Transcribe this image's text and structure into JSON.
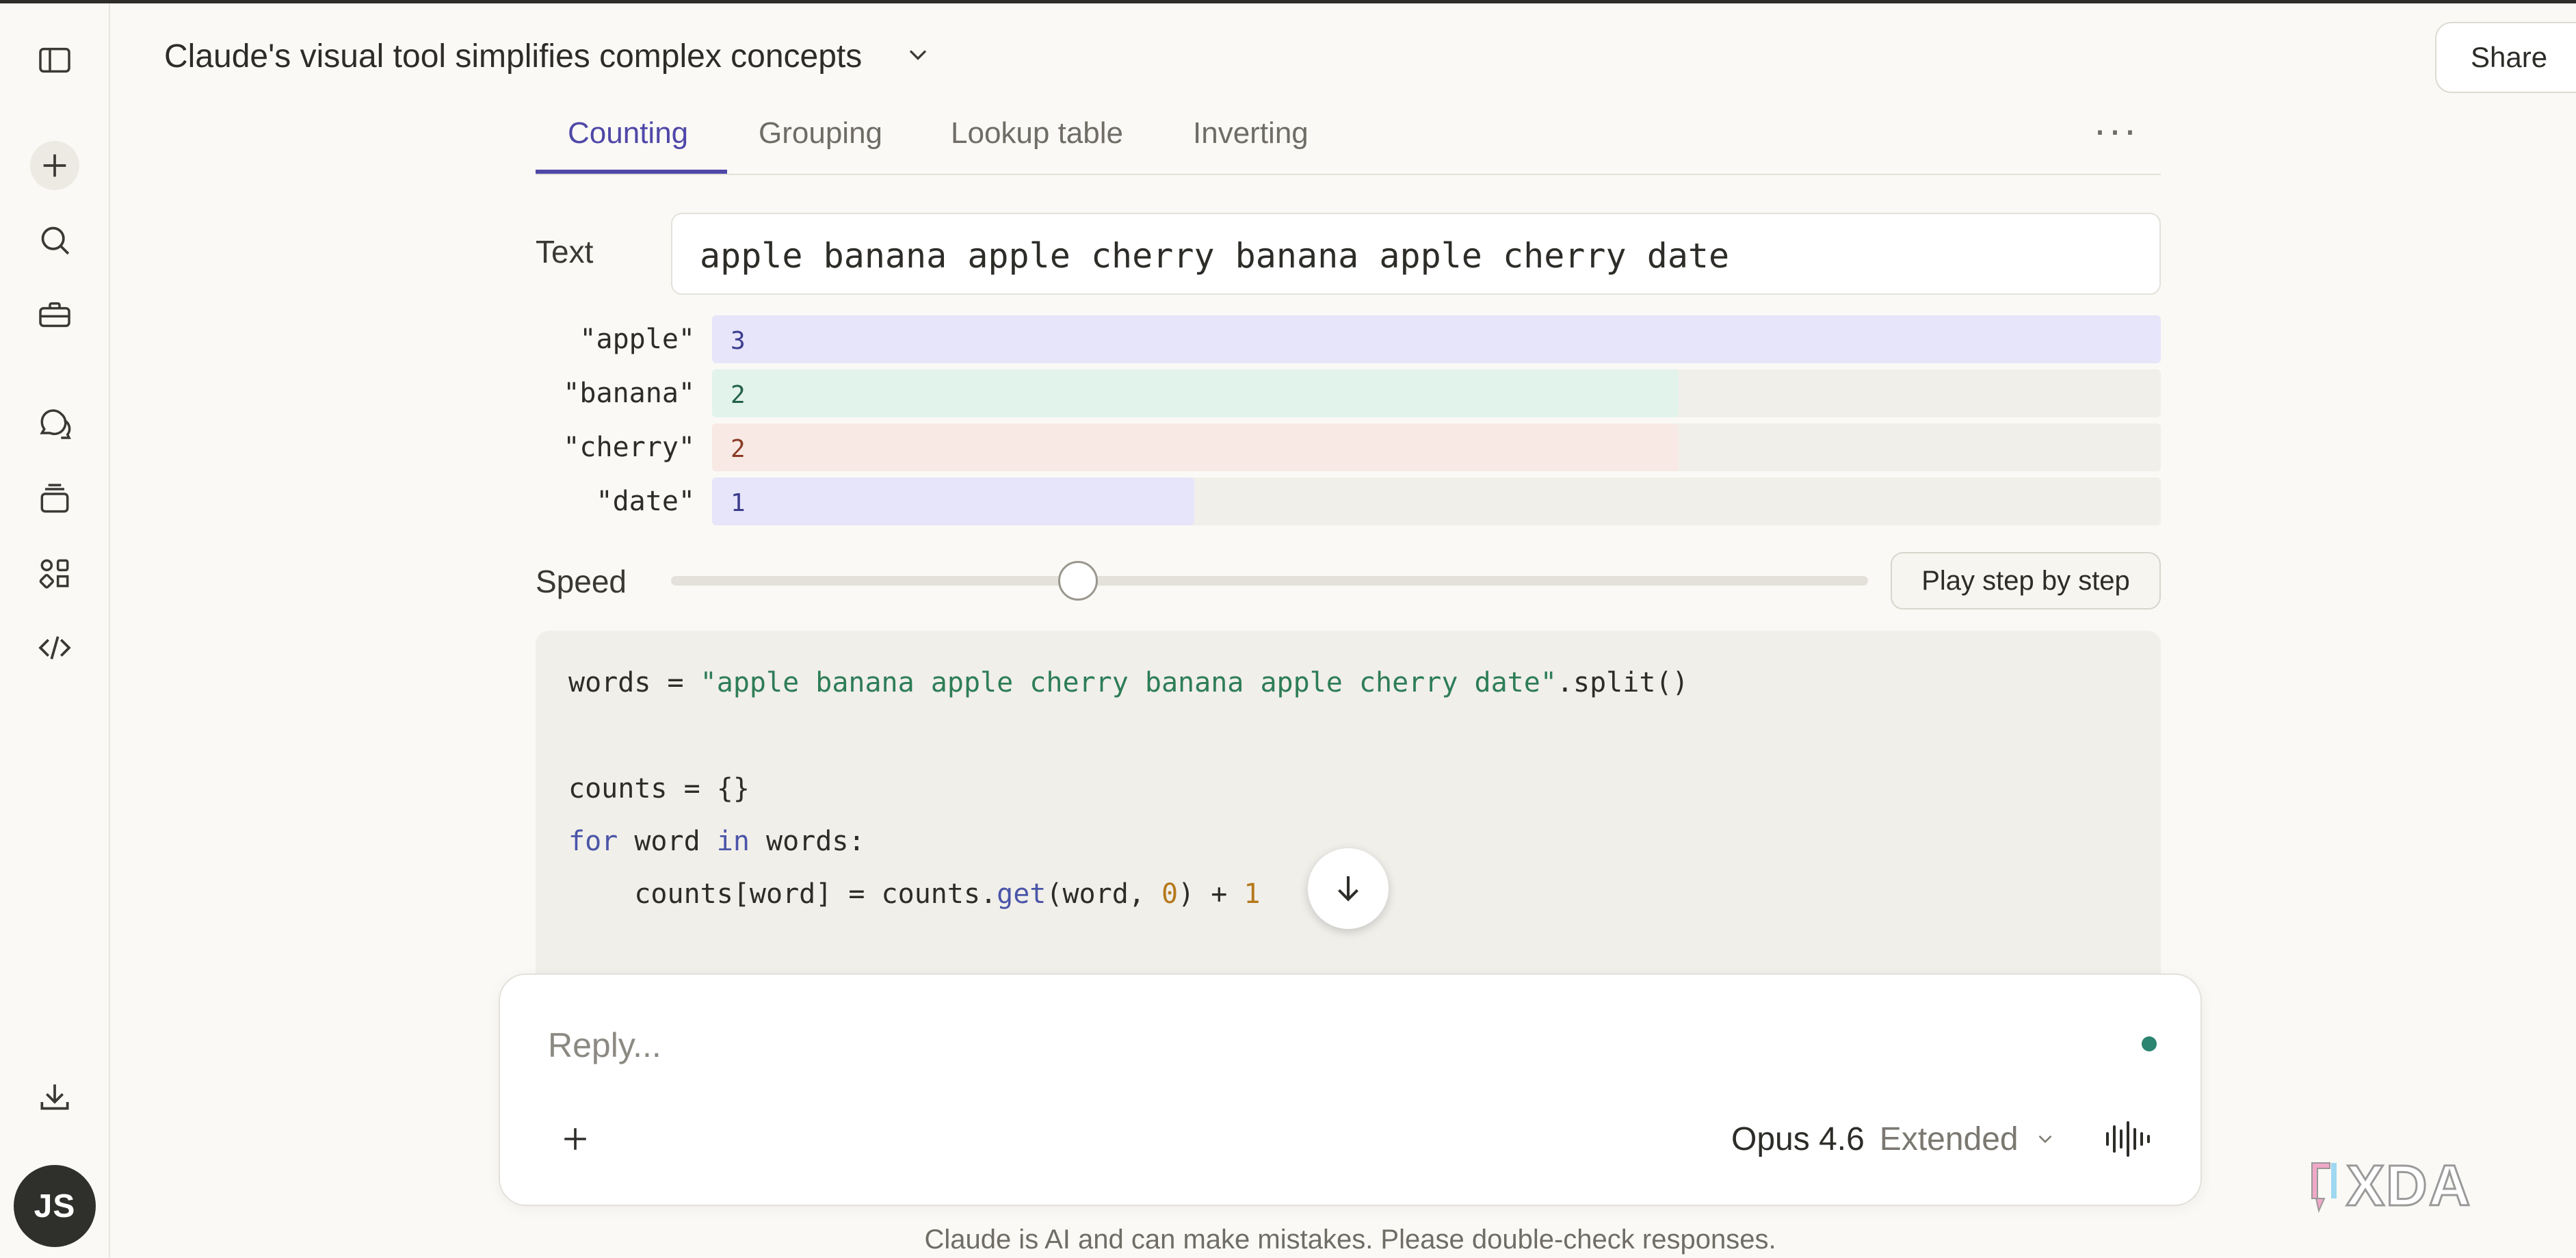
{
  "header": {
    "title": "Claude's visual tool simplifies complex concepts",
    "share_label": "Share"
  },
  "sidebar": {
    "avatar_initials": "JS",
    "icons": [
      "sidebar-toggle-icon",
      "new-chat-icon",
      "search-icon",
      "toolbox-icon",
      "chats-icon",
      "projects-icon",
      "artifacts-icon",
      "code-icon",
      "download-icon"
    ]
  },
  "artifact": {
    "tabs": [
      "Counting",
      "Grouping",
      "Lookup table",
      "Inverting"
    ],
    "active_tab": "Counting",
    "text_label": "Text",
    "text_value": "apple banana apple cherry banana apple cherry date",
    "counts": [
      {
        "word": "\"apple\"",
        "count": "3",
        "fraction": 1.0,
        "fill": "#e6e5fa",
        "color": "#3b3c8c"
      },
      {
        "word": "\"banana\"",
        "count": "2",
        "fraction": 0.667,
        "fill": "#e2f3ec",
        "color": "#23624a"
      },
      {
        "word": "\"cherry\"",
        "count": "2",
        "fraction": 0.667,
        "fill": "#f8e9e4",
        "color": "#8a3b24"
      },
      {
        "word": "\"date\"",
        "count": "1",
        "fraction": 0.333,
        "fill": "#e6e5fa",
        "color": "#3b3c8c"
      }
    ],
    "speed_label": "Speed",
    "speed_level": 0.34,
    "play_label": "Play step by step",
    "code": {
      "l1_a": "words = ",
      "l1_str": "\"apple banana apple cherry banana apple cherry date\"",
      "l1_b": ".split()",
      "l2": "counts = {}",
      "l3_kw1": "for",
      "l3_a": " word ",
      "l3_kw2": "in",
      "l3_b": " words:",
      "l4_a": "    counts[word] = counts.",
      "l4_fn": "get",
      "l4_b": "(word, ",
      "l4_num1": "0",
      "l4_c": ") + ",
      "l4_num2": "1"
    }
  },
  "composer": {
    "placeholder": "Reply...",
    "model_name": "Opus 4.6",
    "model_mode": "Extended"
  },
  "footer": {
    "disclaimer": "Claude is AI and can make mistakes. Please double-check responses."
  },
  "watermark": {
    "text": "XDA"
  }
}
